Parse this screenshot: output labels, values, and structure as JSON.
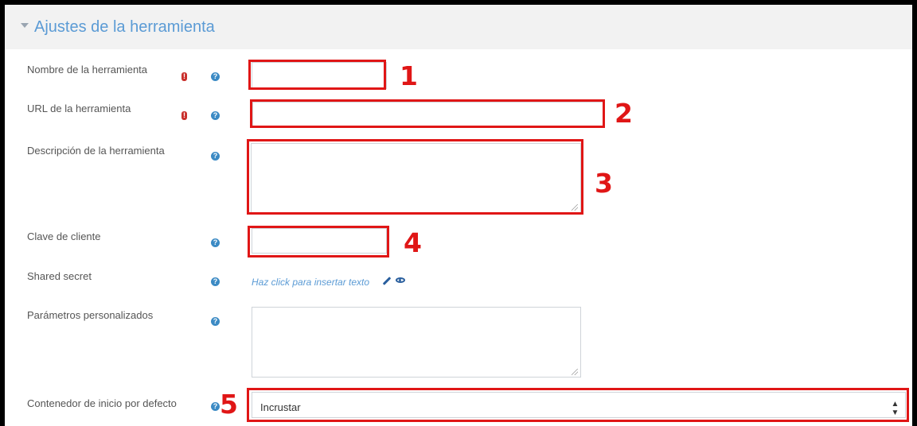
{
  "section": {
    "title": "Ajustes de la herramienta"
  },
  "fields": {
    "tool_name": {
      "label": "Nombre de la herramienta",
      "value": ""
    },
    "tool_url": {
      "label": "URL de la herramienta",
      "value": ""
    },
    "tool_description": {
      "label": "Descripción de la herramienta",
      "value": ""
    },
    "client_key": {
      "label": "Clave de cliente",
      "value": ""
    },
    "shared_secret": {
      "label": "Shared secret",
      "link_text": "Haz click para insertar texto"
    },
    "custom_params": {
      "label": "Parámetros personalizados",
      "value": ""
    },
    "launch_container": {
      "label": "Contenedor de inicio por defecto",
      "selected": "Incrustar"
    }
  },
  "icons": {
    "required": "!",
    "help": "?",
    "select_arrows": "▲▼"
  },
  "callouts": [
    "1",
    "2",
    "3",
    "4",
    "5"
  ],
  "colors": {
    "accent": "#5b9bd5",
    "required": "#c9302c",
    "help": "#3b8ac4",
    "highlight": "#e01616"
  }
}
